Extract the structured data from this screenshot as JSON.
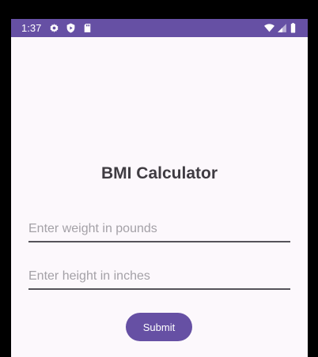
{
  "status_bar": {
    "time": "1:37",
    "left_icons": [
      "gear-icon",
      "shield-play-icon",
      "sd-card-icon"
    ],
    "right_icons": [
      "wifi-icon",
      "signal-icon",
      "battery-icon"
    ],
    "color": "#6650a4"
  },
  "app": {
    "title": "BMI Calculator",
    "weight_input": {
      "placeholder": "Enter weight in pounds",
      "value": ""
    },
    "height_input": {
      "placeholder": "Enter height in inches",
      "value": ""
    },
    "submit_label": "Submit",
    "accent_color": "#6650a4",
    "background_color": "#fcf8fc"
  }
}
